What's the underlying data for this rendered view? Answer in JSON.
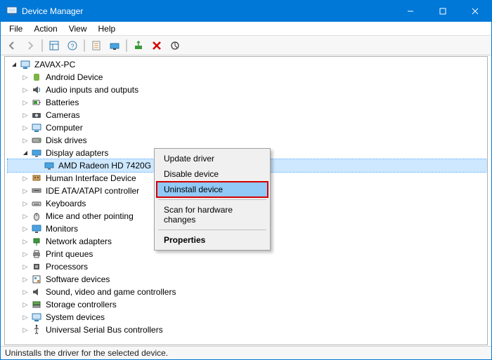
{
  "titlebar": {
    "title": "Device Manager"
  },
  "menu": {
    "file": "File",
    "action": "Action",
    "view": "View",
    "help": "Help"
  },
  "tree": {
    "root": "ZAVAX-PC",
    "nodes": [
      {
        "label": "Android Device"
      },
      {
        "label": "Audio inputs and outputs"
      },
      {
        "label": "Batteries"
      },
      {
        "label": "Cameras"
      },
      {
        "label": "Computer"
      },
      {
        "label": "Disk drives"
      },
      {
        "label": "Display adapters"
      },
      {
        "label": "Human Interface Device"
      },
      {
        "label": "IDE ATA/ATAPI controller"
      },
      {
        "label": "Keyboards"
      },
      {
        "label": "Mice and other pointing"
      },
      {
        "label": "Monitors"
      },
      {
        "label": "Network adapters"
      },
      {
        "label": "Print queues"
      },
      {
        "label": "Processors"
      },
      {
        "label": "Software devices"
      },
      {
        "label": "Sound, video and game controllers"
      },
      {
        "label": "Storage controllers"
      },
      {
        "label": "System devices"
      },
      {
        "label": "Universal Serial Bus controllers"
      }
    ],
    "display_child": "AMD Radeon HD 7420G"
  },
  "context_menu": {
    "update": "Update driver",
    "disable": "Disable device",
    "uninstall": "Uninstall device",
    "scan": "Scan for hardware changes",
    "properties": "Properties"
  },
  "status": "Uninstalls the driver for the selected device."
}
